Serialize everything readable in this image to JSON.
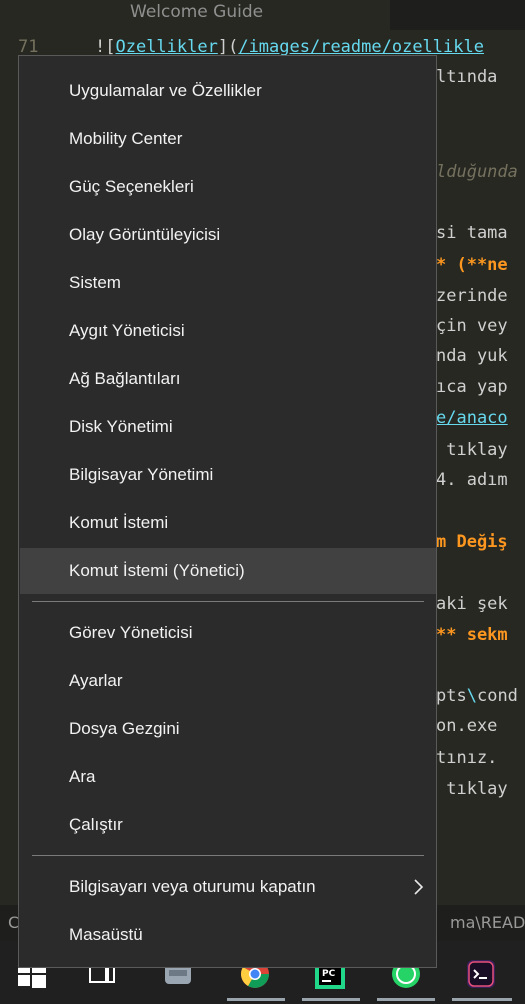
{
  "editor": {
    "tab_title": "Welcome Guide",
    "line_number": "71",
    "line71": {
      "a": "![",
      "b": "Ozellikler",
      "c": "](",
      "d": "/images/readme/ozellikle"
    },
    "fragments": [
      "ltında",
      "lduğunda",
      "si tama",
      "* (**ne",
      "zerinde",
      "çin vey",
      "nda yuk",
      "ıca yap",
      "e/anaco",
      " tıklay",
      "4. adım",
      "m Değiş",
      "aki şek",
      "** sekm",
      "pts",
      "\\",
      "cond",
      "on.exe",
      "tınız.",
      " tıklay"
    ],
    "status_left": "C",
    "status_right": "ma\\READM"
  },
  "menu": {
    "group1": [
      "Uygulamalar ve Özellikler",
      "Mobility Center",
      "Güç Seçenekleri",
      "Olay Görüntüleyicisi",
      "Sistem",
      "Aygıt Yöneticisi",
      "Ağ Bağlantıları",
      "Disk Yönetimi",
      "Bilgisayar Yönetimi",
      "Komut İstemi",
      "Komut İstemi (Yönetici)"
    ],
    "group2": [
      "Görev Yöneticisi",
      "Ayarlar",
      "Dosya Gezgini",
      "Ara",
      "Çalıştır"
    ],
    "group3": [
      "Bilgisayarı veya oturumu kapatın",
      "Masaüstü"
    ],
    "highlighted": "Komut İstemi (Yönetici)"
  },
  "taskbar": {
    "icons": [
      "windows-start-icon",
      "task-view-icon",
      "disk-utility-icon",
      "chrome-icon",
      "pycharm-icon",
      "whatsapp-icon",
      "terminal-icon"
    ],
    "pycharm_text": "PC"
  }
}
